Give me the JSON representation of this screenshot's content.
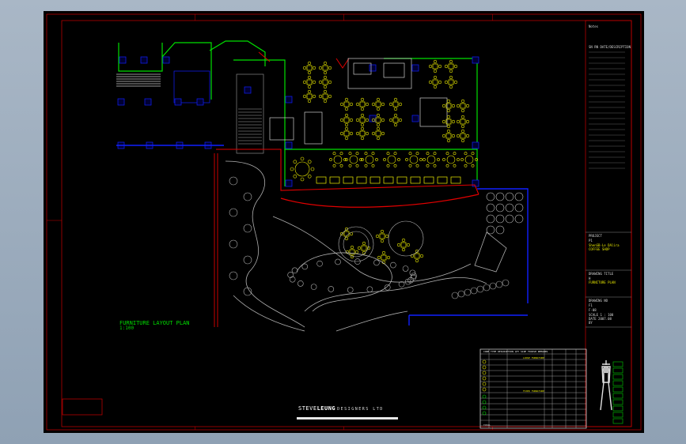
{
  "drawing": {
    "plan_title": "FURNITURE LAYOUT PLAN",
    "plan_scale": "1:100"
  },
  "title_block": {
    "notes_label": "Notes",
    "notes_value": "",
    "rev_header": "SN  RN  DATE/DESCRIPTION",
    "project_label": "PROJECT",
    "project_no": "P1",
    "project_name_1": "ShenSB-Le DAlira",
    "project_name_2": "COFFEE SHOP",
    "drawing_title_label": "DRAWING TITLE",
    "drawing_title_no": "H",
    "drawing_title": "FURNITURE PLAN",
    "drawing_no_label": "DRAWING NO",
    "drawing_no_1": "F1",
    "drawing_no_2": "F-08",
    "scale_line": "SCALE   1 : 100",
    "date_line": "DATE    2007.08",
    "sheet_line": "BY"
  },
  "brand": {
    "name_a": "STEVE",
    "name_b": "LEUNG",
    "sub": "DESIGNERS LTD"
  },
  "schedule": {
    "headers": [
      "CODE",
      "TYPE",
      "DESCRIPTION",
      "QTY",
      "SIZE",
      "FINISH",
      "REMARKS"
    ],
    "group1": "LOOSE FURNITURE",
    "group2": "FIXED FURNITURE",
    "footer": "TOTAL"
  },
  "colors": {
    "cad_background": "#000000",
    "wall_green": "#00e000",
    "column_blue": "#1020ff",
    "boundary_red": "#e00000",
    "furniture_yellow": "#f0f000",
    "landscape_grey": "#b0b0b0"
  }
}
